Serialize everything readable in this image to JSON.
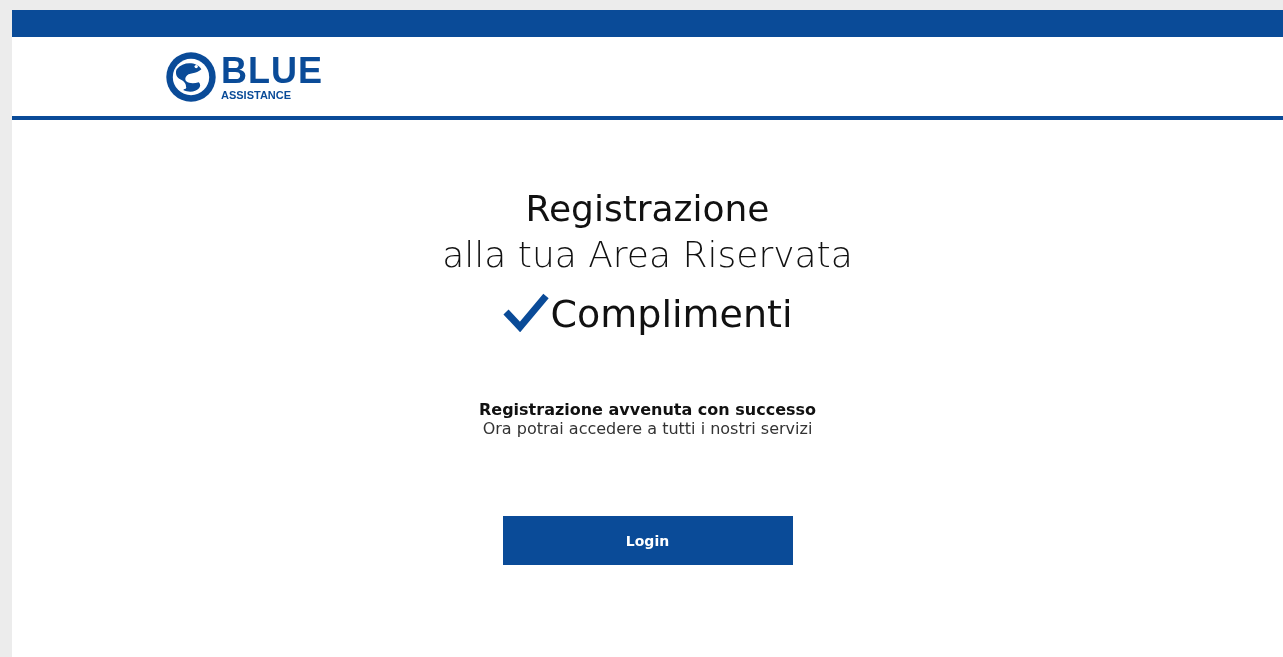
{
  "logo": {
    "name": "BLUE",
    "subtitle": "ASSISTANCE"
  },
  "heading": {
    "title": "Registrazione",
    "subtitle": "alla tua Area Riservata"
  },
  "status": {
    "success": true,
    "text": "Complimenti"
  },
  "message": {
    "title": "Registrazione avvenuta con successo",
    "body": "Ora potrai accedere a tutti i nostri servizi"
  },
  "buttons": [
    "Login"
  ]
}
